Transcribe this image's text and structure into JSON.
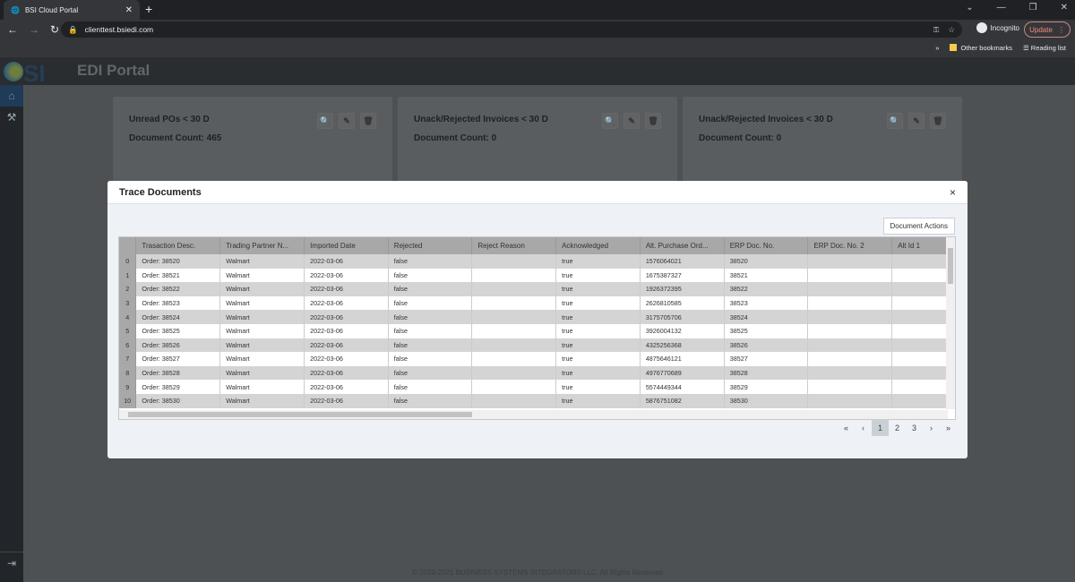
{
  "browser": {
    "tab_title": "BSI Cloud Portal",
    "url": "clienttest.bsiedi.com",
    "incognito": "Incognito",
    "update": "Update",
    "bookmarks": [
      "Other bookmarks",
      "Reading list"
    ]
  },
  "app": {
    "logo_text": "bSI",
    "title": "EDI Portal",
    "footer": "© 2020-2021 BUSINESS SYSTEMS INTEGRATORS LLC. All Rights Reserved"
  },
  "cards": [
    {
      "title": "Unread POs < 30 D",
      "count": "Document Count: 465"
    },
    {
      "title": "Unack/Rejected Invoices < 30 D",
      "count": "Document Count: 0"
    },
    {
      "title": "Unack/Rejected Invoices < 30 D",
      "count": "Document Count: 0"
    }
  ],
  "modal": {
    "title": "Trace Documents",
    "close": "×",
    "document_actions": "Document Actions",
    "columns": [
      "Trasaction Desc.",
      "Trading Partner N...",
      "Imported Date",
      "Rejected",
      "Reject Reason",
      "Acknowledged",
      "Alt. Purchase Ord...",
      "ERP Doc. No.",
      "ERP Doc. No. 2",
      "Alt Id 1"
    ],
    "rows": [
      [
        "0",
        "Order: 38520",
        "Walmart",
        "2022-03-06",
        "false",
        "",
        "true",
        "1576064021",
        "38520",
        "",
        ""
      ],
      [
        "1",
        "Order: 38521",
        "Walmart",
        "2022-03-06",
        "false",
        "",
        "true",
        "1675387327",
        "38521",
        "",
        ""
      ],
      [
        "2",
        "Order: 38522",
        "Walmart",
        "2022-03-06",
        "false",
        "",
        "true",
        "1926372395",
        "38522",
        "",
        ""
      ],
      [
        "3",
        "Order: 38523",
        "Walmart",
        "2022-03-06",
        "false",
        "",
        "true",
        "2626810585",
        "38523",
        "",
        ""
      ],
      [
        "4",
        "Order: 38524",
        "Walmart",
        "2022-03-06",
        "false",
        "",
        "true",
        "3175705706",
        "38524",
        "",
        ""
      ],
      [
        "5",
        "Order: 38525",
        "Walmart",
        "2022-03-06",
        "false",
        "",
        "true",
        "3926004132",
        "38525",
        "",
        ""
      ],
      [
        "6",
        "Order: 38526",
        "Walmart",
        "2022-03-06",
        "false",
        "",
        "true",
        "4325256368",
        "38526",
        "",
        ""
      ],
      [
        "7",
        "Order: 38527",
        "Walmart",
        "2022-03-06",
        "false",
        "",
        "true",
        "4875646121",
        "38527",
        "",
        ""
      ],
      [
        "8",
        "Order: 38528",
        "Walmart",
        "2022-03-06",
        "false",
        "",
        "true",
        "4976770689",
        "38528",
        "",
        ""
      ],
      [
        "9",
        "Order: 38529",
        "Walmart",
        "2022-03-06",
        "false",
        "",
        "true",
        "5574449344",
        "38529",
        "",
        ""
      ],
      [
        "10",
        "Order: 38530",
        "Walmart",
        "2022-03-06",
        "false",
        "",
        "true",
        "5876751082",
        "38530",
        "",
        ""
      ]
    ],
    "pager": {
      "first": "«",
      "prev": "‹",
      "pages": [
        "1",
        "2",
        "3"
      ],
      "current": "1",
      "next": "›",
      "last": "»"
    }
  }
}
